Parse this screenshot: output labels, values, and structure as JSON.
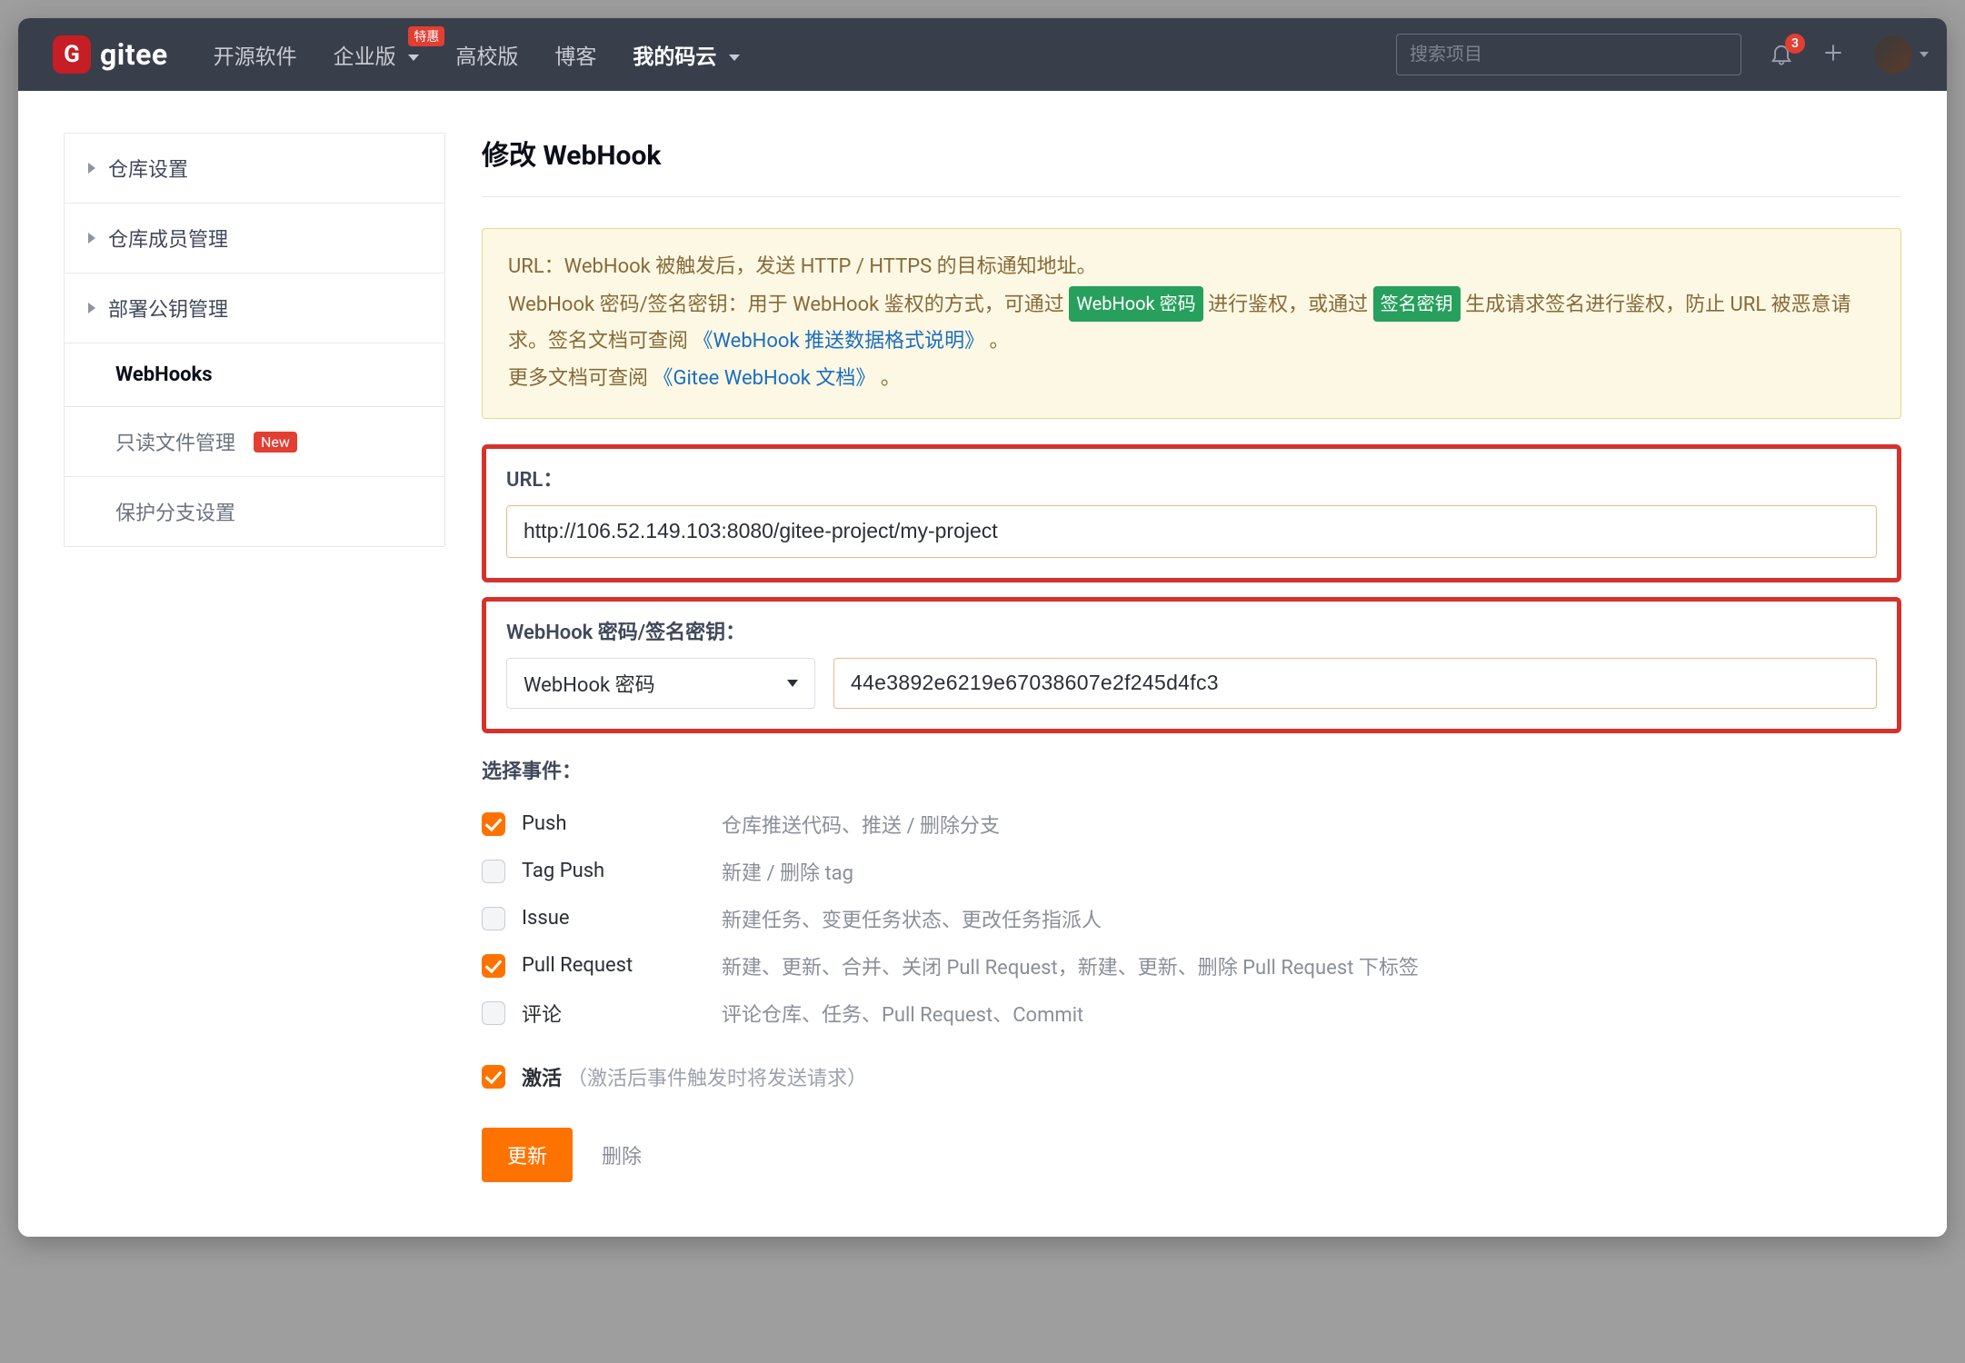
{
  "header": {
    "logo_letter": "G",
    "logo_text": "gitee",
    "nav": {
      "open_source": "开源软件",
      "enterprise": "企业版",
      "enterprise_promo": "特惠",
      "campus": "高校版",
      "blog": "博客",
      "my": "我的码云"
    },
    "search_placeholder": "搜索项目",
    "notif_count": "3"
  },
  "sidebar": {
    "groups": {
      "repo_settings": "仓库设置",
      "members": "仓库成员管理",
      "deploy_keys": "部署公钥管理"
    },
    "links": {
      "webhooks": "WebHooks",
      "readonly": "只读文件管理",
      "readonly_tag": "New",
      "branch_protect": "保护分支设置"
    }
  },
  "page": {
    "title": "修改 WebHook",
    "info": {
      "line1a": "URL：WebHook 被触发后，发送 HTTP / HTTPS 的目标通知地址。",
      "line2a": "WebHook 密码/签名密钥：用于 WebHook 鉴权的方式，可通过 ",
      "pill_pwd": "WebHook 密码",
      "line2b": " 进行鉴权，或通过 ",
      "pill_sign": "签名密钥",
      "line2c": " 生成请求签名进行鉴权，防止 URL 被恶意请求。签名文档可查阅 ",
      "doc1": "《WebHook 推送数据格式说明》",
      "line2d": " 。",
      "line3a": "更多文档可查阅 ",
      "doc2": "《Gitee WebHook 文档》",
      "line3b": " 。"
    },
    "url_label": "URL：",
    "url_value": "http://106.52.149.103:8080/gitee-project/my-project",
    "secret_label": "WebHook 密码/签名密钥：",
    "secret_type": "WebHook 密码",
    "secret_value": "44e3892e6219e67038607e2f245d4fc3",
    "events_label": "选择事件：",
    "events": [
      {
        "name": "Push",
        "desc": "仓库推送代码、推送 / 删除分支",
        "checked": true
      },
      {
        "name": "Tag Push",
        "desc": "新建 / 删除 tag",
        "checked": false
      },
      {
        "name": "Issue",
        "desc": "新建任务、变更任务状态、更改任务指派人",
        "checked": false
      },
      {
        "name": "Pull Request",
        "desc": "新建、更新、合并、关闭 Pull Request，新建、更新、删除 Pull Request 下标签",
        "checked": true
      },
      {
        "name": "评论",
        "desc": "评论仓库、任务、Pull Request、Commit",
        "checked": false
      }
    ],
    "activate_label": "激活",
    "activate_hint": "（激活后事件触发时将发送请求）",
    "activate_checked": true,
    "btn_update": "更新",
    "btn_delete": "删除"
  }
}
